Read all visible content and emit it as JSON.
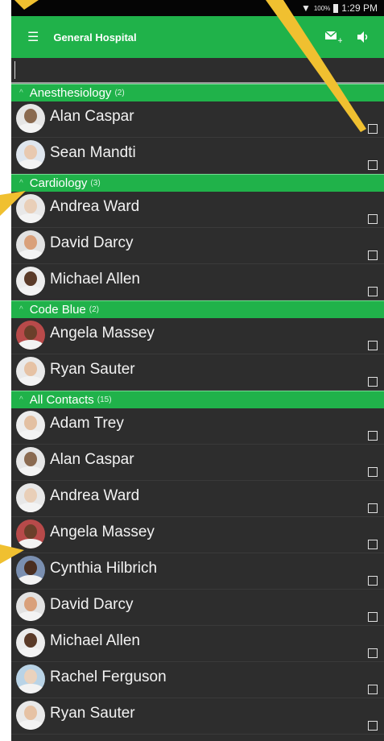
{
  "status": {
    "battery": "100%",
    "time": "1:29 PM"
  },
  "header": {
    "title": "General Hospital"
  },
  "search": {
    "placeholder": ""
  },
  "sections": [
    {
      "title": "Anesthesiology",
      "count": "(2)",
      "contacts": [
        {
          "name": "Alan Caspar",
          "skin": "#8a6a50",
          "bg": "#e6e6e6"
        },
        {
          "name": "Sean Mandti",
          "skin": "#e8c9b0",
          "bg": "#dfe6ee"
        }
      ]
    },
    {
      "title": "Cardiology",
      "count": "(3)",
      "contacts": [
        {
          "name": "Andrea Ward",
          "skin": "#e9cfb8",
          "bg": "#e8e8e8"
        },
        {
          "name": "David Darcy",
          "skin": "#d9a07a",
          "bg": "#e2e2e2"
        },
        {
          "name": "Michael Allen",
          "skin": "#5a3a28",
          "bg": "#ececec"
        }
      ]
    },
    {
      "title": "Code Blue",
      "count": "(2)",
      "contacts": [
        {
          "name": "Angela Massey",
          "skin": "#6b3f2a",
          "bg": "#b84a4a"
        },
        {
          "name": "Ryan Sauter",
          "skin": "#e6c2a4",
          "bg": "#e9e9e9"
        }
      ]
    },
    {
      "title": "All Contacts",
      "count": "(15)",
      "contacts": [
        {
          "name": "Adam Trey",
          "skin": "#e3c0a2",
          "bg": "#ededed"
        },
        {
          "name": "Alan Caspar",
          "skin": "#8a6a50",
          "bg": "#e6e6e6"
        },
        {
          "name": "Andrea Ward",
          "skin": "#e9cfb8",
          "bg": "#e8e8e8"
        },
        {
          "name": "Angela Massey",
          "skin": "#6b3f2a",
          "bg": "#b84a4a"
        },
        {
          "name": "Cynthia Hilbrich",
          "skin": "#4a2e20",
          "bg": "#7a8fb0"
        },
        {
          "name": "David Darcy",
          "skin": "#d9a07a",
          "bg": "#e2e2e2"
        },
        {
          "name": "Michael Allen",
          "skin": "#5a3a28",
          "bg": "#ececec"
        },
        {
          "name": "Rachel Ferguson",
          "skin": "#ead2bd",
          "bg": "#b9d3e6"
        },
        {
          "name": "Ryan Sauter",
          "skin": "#e6c2a4",
          "bg": "#e9e9e9"
        }
      ]
    }
  ],
  "colors": {
    "accent": "#20b24a",
    "list_bg": "#2d2d2d",
    "callout": "#f0c030"
  }
}
